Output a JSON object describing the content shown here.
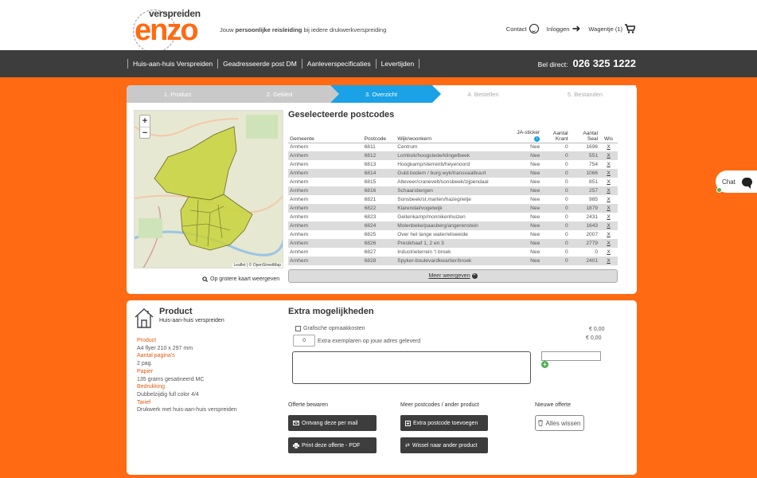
{
  "brand": {
    "small": "verspreiden",
    "big": "enzo"
  },
  "tagline": {
    "pre": "Jouw ",
    "bold": "persoonlijke reisleiding",
    "post": " bij iedere drukwerkverspreiding"
  },
  "top_links": {
    "contact": "Contact",
    "login": "Inloggen",
    "cart": "Wagentje (1)"
  },
  "nav": [
    "Huis-aan-huis Verspreiden",
    "Geadresseerde post DM",
    "Aanleverspecificaties",
    "Levertijden"
  ],
  "phone": {
    "label": "Bel direct:",
    "number": "026 325 1222"
  },
  "steps": [
    "1. Product",
    "2. Gebied",
    "3. Overzicht",
    "4. Bestellen",
    "5. Bestanden"
  ],
  "map": {
    "attribution": "Leaflet | © OpenStreetMap",
    "zoom_in": "+",
    "zoom_out": "−",
    "bigger": "Op grotere kaart weergeven"
  },
  "postcodes": {
    "title": "Geselecteerde postcodes",
    "headers": {
      "gemeente": "Gemeente",
      "postcode": "Postcode",
      "wijk": "Wijk/woonkern",
      "sticker": "JA-sticker",
      "krant": "Aantal Krant",
      "seal": "Aantal Seal",
      "wis": "Wis"
    },
    "rows": [
      [
        "Arnhem",
        "6811",
        "Centrum",
        "Nee",
        "0",
        "1696",
        "X"
      ],
      [
        "Arnhem",
        "6812",
        "Lombok/hoogstede/klingelbeek",
        "Nee",
        "0",
        "551",
        "X"
      ],
      [
        "Arnhem",
        "6813",
        "Hoogkamp/sterrenb/heyenoord",
        "Nee",
        "0",
        "754",
        "X"
      ],
      [
        "Arnhem",
        "6814",
        "Guld.bodem / burg.wyk/transvaalbuurt",
        "Nee",
        "0",
        "1066",
        "X"
      ],
      [
        "Arnhem",
        "6815",
        "Alteveer/cranevelt/sonsbeek/zijpendaal",
        "Nee",
        "0",
        "851",
        "X"
      ],
      [
        "Arnhem",
        "6816",
        "Schaarsbergen",
        "Nee",
        "0",
        "257",
        "X"
      ],
      [
        "Arnhem",
        "6821",
        "Sonsbeek/st.marten/hazegrietje",
        "Nee",
        "0",
        "985",
        "X"
      ],
      [
        "Arnhem",
        "6822",
        "Klarendal/vogelwijk",
        "Nee",
        "0",
        "1879",
        "X"
      ],
      [
        "Arnhem",
        "6823",
        "Geitenkamp/monnikenhuizen",
        "Nee",
        "0",
        "2431",
        "X"
      ],
      [
        "Arnhem",
        "6824",
        "Molenbeke/paasberg/angerenstein",
        "Nee",
        "0",
        "1643",
        "X"
      ],
      [
        "Arnhem",
        "6825",
        "Over het lange water/elsweide",
        "Nee",
        "0",
        "2007",
        "X"
      ],
      [
        "Arnhem",
        "6826",
        "Presikhaaf 1, 2 en 3",
        "Nee",
        "0",
        "2779",
        "X"
      ],
      [
        "Arnhem",
        "6827",
        "Industrieterrein 't broek",
        "Nee",
        "0",
        "0",
        "X"
      ],
      [
        "Arnhem",
        "6828",
        "Spyker-boulevardkwartier/broek",
        "Nee",
        "0",
        "2401",
        "X"
      ]
    ],
    "more": "Meer weergeven"
  },
  "product": {
    "title": "Product",
    "subtitle": "Huis-aan-huis verspreiden",
    "specs": [
      {
        "k": "Product",
        "v": "A4 flyer 210 x 297 mm"
      },
      {
        "k": "Aantal pagina's",
        "v": "2 pag."
      },
      {
        "k": "Papier",
        "v": "135 grams gesatineerd MC"
      },
      {
        "k": "Bedrukking",
        "v": "Dubbelzijdig full color 4/4"
      },
      {
        "k": "Tarief",
        "v": "Drukwerk met huis-aan-huis verspreiden"
      }
    ]
  },
  "extras": {
    "title": "Extra mogelijkheden",
    "grafische": "Grafische opmaakkosten",
    "price1": "€ 0,00",
    "qty": "0",
    "qty_label": "Extra exemplaren op jouw adres geleverd",
    "price2": "€ 0,00"
  },
  "actions": {
    "offerte_head": "Offerte bewaren",
    "mail": "Ontvang deze per mail",
    "print": "Print deze offerte - PDF",
    "meer_head": "Meer postcodes / ander product",
    "extra_pc": "Extra postcode toevoegen",
    "wissel": "Wissel naar ander product",
    "nieuw_head": "Nieuwe offerte",
    "wissen": "Alles wissen"
  },
  "chat": {
    "label": "Chat"
  },
  "colors": {
    "brand": "#ff6a13",
    "dark": "#3d3d3d",
    "step_active": "#1aa1e6",
    "map_fill": "#c8d23a"
  }
}
